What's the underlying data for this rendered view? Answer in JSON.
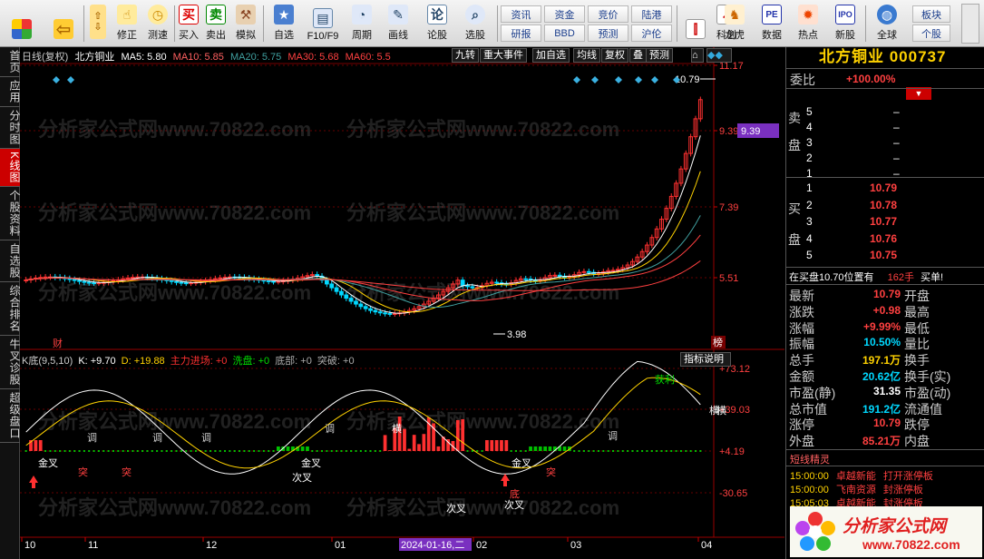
{
  "toolbar": {
    "buttons": [
      {
        "label": "",
        "icon": "grid-icon"
      },
      {
        "label": "",
        "icon": "back-arrow-icon"
      },
      {
        "label": "修正",
        "icon": "hand-icon"
      },
      {
        "label": "测速",
        "icon": "clock-icon"
      },
      {
        "label": "买入",
        "icon": "buy-icon",
        "glyph": "买"
      },
      {
        "label": "卖出",
        "icon": "sell-icon",
        "glyph": "卖"
      },
      {
        "label": "模拟",
        "icon": "hammer-icon"
      },
      {
        "label": "自选",
        "icon": "star-icon"
      },
      {
        "label": "F10/F9",
        "icon": "f10-icon"
      },
      {
        "label": "周期",
        "icon": "period-icon"
      },
      {
        "label": "画线",
        "icon": "pencil-icon"
      },
      {
        "label": "论股",
        "icon": "forum-icon",
        "glyph": "论"
      },
      {
        "label": "选股",
        "icon": "magnifier-icon"
      }
    ],
    "small_buttons": [
      "资讯",
      "资金",
      "竞价",
      "陆港",
      "研报",
      "BBD",
      "预测",
      "沪伦"
    ],
    "right_buttons": [
      {
        "label": "K线",
        "icon": "kline-icon"
      },
      {
        "label": "科创",
        "icon": "chart-icon"
      },
      {
        "label": "龙虎",
        "icon": "dragon-icon"
      },
      {
        "label": "数据",
        "icon": "pe-icon",
        "glyph": "PE"
      },
      {
        "label": "热点",
        "icon": "fire-icon"
      },
      {
        "label": "新股",
        "icon": "ipo-icon",
        "glyph": "IPO"
      },
      {
        "label": "全球",
        "icon": "globe-icon"
      }
    ],
    "far_right": [
      "板块",
      "个股"
    ]
  },
  "left_tabs": [
    {
      "label": "首页",
      "active": false
    },
    {
      "label": "应用",
      "active": false
    },
    {
      "label": "分时图",
      "active": false
    },
    {
      "label": "K线图",
      "active": true
    },
    {
      "label": "个股资料",
      "active": false
    },
    {
      "label": "自选股",
      "active": false
    },
    {
      "label": "综合排名",
      "active": false
    },
    {
      "label": "牛叉诊股",
      "active": false
    },
    {
      "label": "超级盘口",
      "active": false
    }
  ],
  "chart_header": {
    "period": "日线(复权)",
    "stock": "北方铜业",
    "ma5": "MA5: 5.80",
    "ma10": "MA10: 5.85",
    "ma20": "MA20: 5.75",
    "ma30": "MA30: 5.68",
    "ma60": "MA60: 5.5",
    "chips": [
      "九转",
      "重大事件",
      "加自选",
      "均线",
      "复权",
      "叠",
      "预测"
    ]
  },
  "indicator_header": {
    "name": "K底(9,5,10)",
    "k": "K: +9.70",
    "d": "D: +19.88",
    "main": "主力进场: +0",
    "wash": "洗盘: +0",
    "bottom": "底部: +0",
    "breakout": "突破: +0",
    "explain_btn": "指标说明"
  },
  "price_axis": [
    "11.17",
    "9.39",
    "7.39",
    "5.51"
  ],
  "indicator_axis": [
    "+73.12",
    "+39.03",
    "+4.19",
    "-30.65"
  ],
  "time_axis": [
    "10",
    "11",
    "12",
    "01",
    "2024-01-16,二",
    "02",
    "03",
    "04"
  ],
  "annotations": {
    "high": "10.79",
    "low": "3.98",
    "cai": "财",
    "bang": "榜",
    "watermark": "分析家公式网www.70822.com",
    "signals": [
      "金叉",
      "突",
      "突",
      "调",
      "调",
      "调",
      "金叉",
      "调",
      "横",
      "次叉",
      "次叉",
      "底",
      "金叉",
      "突",
      "调",
      "横",
      "次叉",
      "获利",
      "横"
    ]
  },
  "right_panel": {
    "title": "北方铜业 000737",
    "weibi_label": "委比",
    "weibi": "+100.00%",
    "sell_label": [
      "卖",
      "盘"
    ],
    "buy_label": [
      "买",
      "盘"
    ],
    "sells": [
      {
        "lvl": "5",
        "price": "–"
      },
      {
        "lvl": "4",
        "price": "–"
      },
      {
        "lvl": "3",
        "price": "–"
      },
      {
        "lvl": "2",
        "price": "–"
      },
      {
        "lvl": "1",
        "price": "–"
      }
    ],
    "buys": [
      {
        "lvl": "1",
        "price": "10.79"
      },
      {
        "lvl": "2",
        "price": "10.78"
      },
      {
        "lvl": "3",
        "price": "10.77"
      },
      {
        "lvl": "4",
        "price": "10.76"
      },
      {
        "lvl": "5",
        "price": "10.75"
      }
    ],
    "notice": "在买盘10.70位置有",
    "notice_qty": "162手",
    "notice_tail": "买单!",
    "quotes": [
      {
        "l1": "最新",
        "v1": "10.79",
        "c1": "red",
        "l2": "开盘",
        "v2": ""
      },
      {
        "l1": "涨跌",
        "v1": "+0.98",
        "c1": "red",
        "l2": "最高",
        "v2": ""
      },
      {
        "l1": "涨幅",
        "v1": "+9.99%",
        "c1": "red",
        "l2": "最低",
        "v2": ""
      },
      {
        "l1": "振幅",
        "v1": "10.50%",
        "c1": "cyan",
        "l2": "量比",
        "v2": ""
      },
      {
        "l1": "总手",
        "v1": "197.1万",
        "c1": "yellow",
        "l2": "换手",
        "v2": ""
      },
      {
        "l1": "金额",
        "v1": "20.62亿",
        "c1": "cyan",
        "l2": "换手(实)",
        "v2": ""
      },
      {
        "l1": "市盈(静)",
        "v1": "31.35",
        "c1": "white",
        "l2": "市盈(动)",
        "v2": ""
      },
      {
        "l1": "总市值",
        "v1": "191.2亿",
        "c1": "cyan",
        "l2": "流通值",
        "v2": ""
      },
      {
        "l1": "涨停",
        "v1": "10.79",
        "c1": "red",
        "l2": "跌停",
        "v2": ""
      },
      {
        "l1": "外盘",
        "v1": "85.21万",
        "c1": "red",
        "l2": "内盘",
        "v2": ""
      }
    ],
    "spirit_title": "短线精灵",
    "spirit": [
      {
        "time": "15:00:00",
        "name": "卓越新能",
        "event": "打开涨停板"
      },
      {
        "time": "15:00:00",
        "name": "飞南资源",
        "event": "封涨停板"
      },
      {
        "time": "15:05:03",
        "name": "卓越新能",
        "event": "封涨停板"
      }
    ],
    "logo_text": "分析家公式网",
    "logo_url": "www.70822.com"
  },
  "colors": {
    "up": "#ff3030",
    "down": "#00d8ff",
    "accent": "#ffd200",
    "panel_bg": "#000000"
  }
}
